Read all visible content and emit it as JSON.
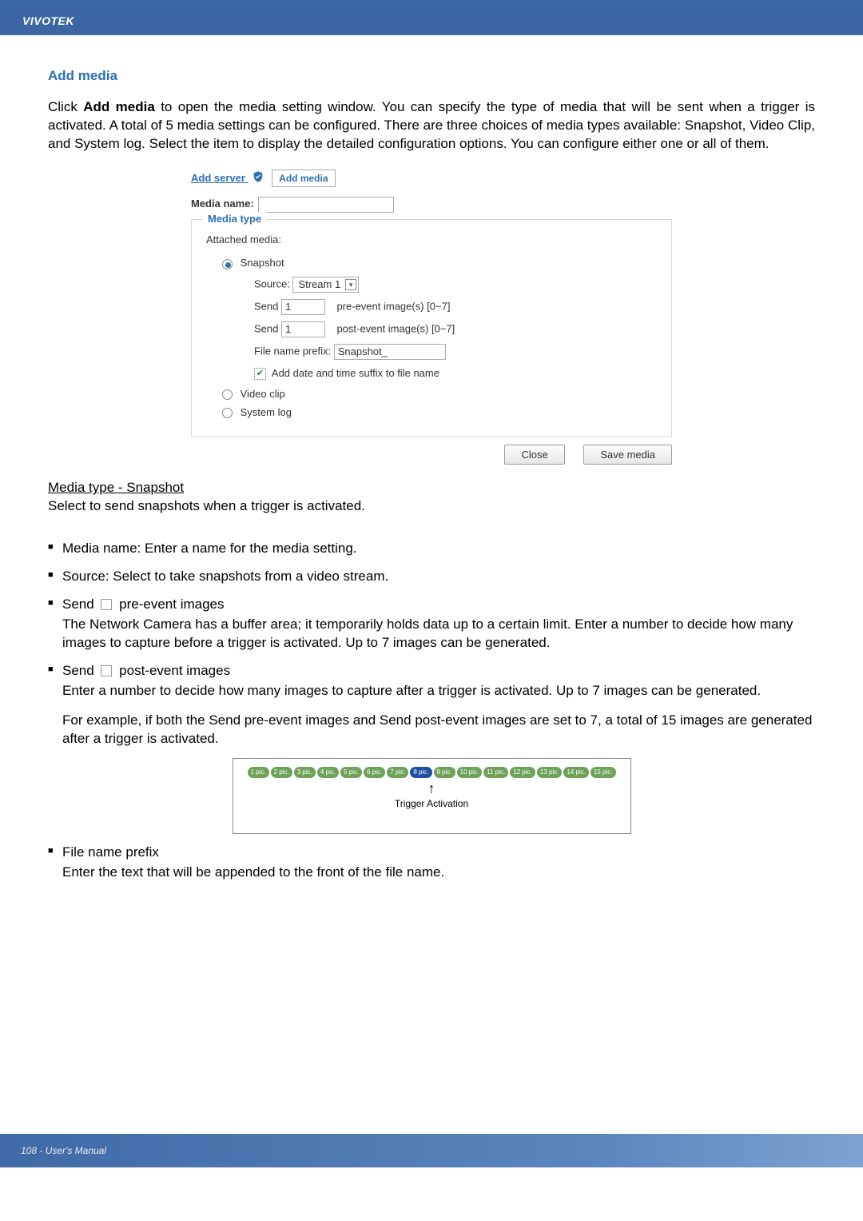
{
  "header": {
    "brand": "VIVOTEK"
  },
  "section": {
    "title": "Add media"
  },
  "intro": {
    "pre": "Click ",
    "bold": "Add media",
    "post": " to open the media setting window. You can specify the type of media that will be sent when a trigger is activated. A total of 5 media settings can be configured. There are three choices of media types available: Snapshot, Video Clip, and System log. Select the item to display the detailed configuration options. You can configure either one or all of them."
  },
  "screenshot": {
    "tabs": {
      "add_server": "Add server",
      "add_media": "Add media"
    },
    "media_name_label": "Media name:",
    "media_name_value": "",
    "media_type_legend": "Media type",
    "attached_media_label": "Attached media:",
    "snapshot": {
      "label": "Snapshot",
      "checked": true,
      "source_label": "Source:",
      "source_value": "Stream 1",
      "send_label": "Send",
      "pre_value": "1",
      "pre_suffix": "pre-event image(s) [0~7]",
      "post_value": "1",
      "post_suffix": "post-event image(s) [0~7]",
      "prefix_label": "File name prefix:",
      "prefix_value": "Snapshot_",
      "suffix_checkbox_label": "Add date and time suffix to file name",
      "suffix_checked": true
    },
    "video_clip": {
      "label": "Video clip",
      "checked": false
    },
    "system_log": {
      "label": "System log",
      "checked": false
    },
    "buttons": {
      "close": "Close",
      "save": "Save media"
    }
  },
  "snapshot_heading": "Media type - Snapshot",
  "snapshot_sub": "Select to send snapshots when a trigger is activated.",
  "bullets": {
    "media_name": "Media name: Enter a name for the media setting.",
    "source": "Source: Select to take snapshots from a video stream.",
    "pre_lead": "Send ",
    "pre_tail": " pre-event images",
    "pre_body": "The Network Camera has a buffer area; it temporarily holds data up to a certain limit. Enter a number to decide how many images to capture before a trigger is activated. Up to 7 images can be generated.",
    "post_lead": "Send ",
    "post_tail": " post-event images",
    "post_body": "Enter a number to decide how many images to capture after a trigger is activated. Up to 7 images can be generated.",
    "example": "For example, if both the Send pre-event images and Send post-event images are set to 7, a total of 15 images are generated after a trigger is activated.",
    "prefix_lead": "File name prefix",
    "prefix_body": "Enter the text that will be appended to the front of the file name."
  },
  "diagram": {
    "pics": [
      "1 pic.",
      "2 pic.",
      "3 pic.",
      "4 pic.",
      "5 pic.",
      "6 pic.",
      "7 pic.",
      "8 pic.",
      "9 pic.",
      "10 pic.",
      "11 pic.",
      "12 pic.",
      "13 pic.",
      "14 pic.",
      "15 pic."
    ],
    "trigger_index": 7,
    "label": "Trigger Activation",
    "src_placeholder": "[diagram]"
  },
  "footer": {
    "text": "108 - User's Manual"
  }
}
